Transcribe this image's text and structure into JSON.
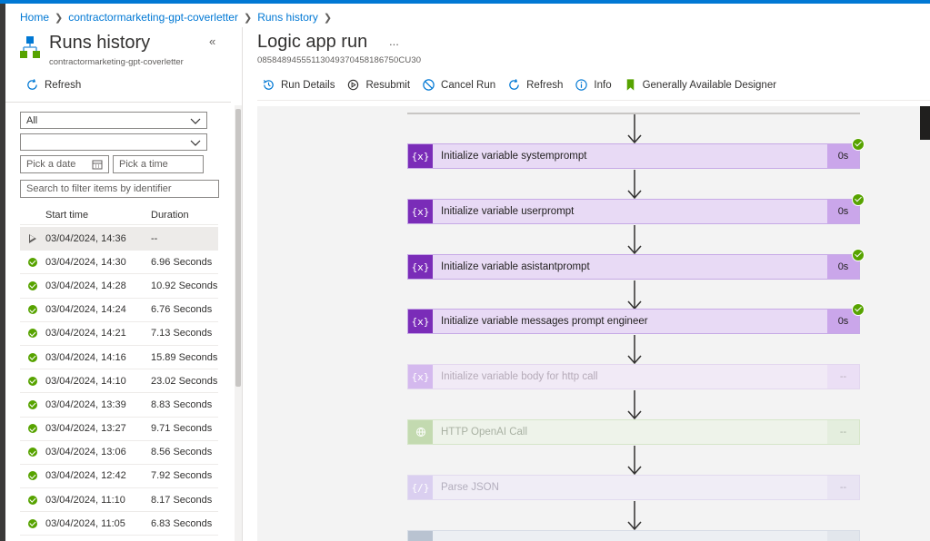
{
  "breadcrumb": [
    "Home",
    "contractormarketing-gpt-coverletter",
    "Runs history"
  ],
  "left_panel": {
    "title": "Runs history",
    "subtitle": "contractormarketing-gpt-coverletter",
    "refresh_label": "Refresh",
    "status_filter": "All",
    "second_filter": "",
    "date_placeholder": "Pick a date",
    "time_placeholder": "Pick a time",
    "search_placeholder": "Search to filter items by identifier",
    "columns": [
      "Start time",
      "Duration"
    ],
    "runs": [
      {
        "status": "running",
        "start": "03/04/2024, 14:36",
        "duration": "--"
      },
      {
        "status": "succeeded",
        "start": "03/04/2024, 14:30",
        "duration": "6.96 Seconds"
      },
      {
        "status": "succeeded",
        "start": "03/04/2024, 14:28",
        "duration": "10.92 Seconds"
      },
      {
        "status": "succeeded",
        "start": "03/04/2024, 14:24",
        "duration": "6.76 Seconds"
      },
      {
        "status": "succeeded",
        "start": "03/04/2024, 14:21",
        "duration": "7.13 Seconds"
      },
      {
        "status": "succeeded",
        "start": "03/04/2024, 14:16",
        "duration": "15.89 Seconds"
      },
      {
        "status": "succeeded",
        "start": "03/04/2024, 14:10",
        "duration": "23.02 Seconds"
      },
      {
        "status": "succeeded",
        "start": "03/04/2024, 13:39",
        "duration": "8.83 Seconds"
      },
      {
        "status": "succeeded",
        "start": "03/04/2024, 13:27",
        "duration": "9.71 Seconds"
      },
      {
        "status": "succeeded",
        "start": "03/04/2024, 13:06",
        "duration": "8.56 Seconds"
      },
      {
        "status": "succeeded",
        "start": "03/04/2024, 12:42",
        "duration": "7.92 Seconds"
      },
      {
        "status": "succeeded",
        "start": "03/04/2024, 11:10",
        "duration": "8.17 Seconds"
      },
      {
        "status": "succeeded",
        "start": "03/04/2024, 11:05",
        "duration": "6.83 Seconds"
      }
    ]
  },
  "main": {
    "title": "Logic app run",
    "more_label": "...",
    "run_id": "08584894555113049370458186750CU30",
    "toolbar": {
      "run_details": "Run Details",
      "resubmit": "Resubmit",
      "cancel_run": "Cancel Run",
      "refresh": "Refresh",
      "info": "Info",
      "designer": "Generally Available Designer"
    },
    "steps": [
      {
        "label": "Initialize variable systemprompt",
        "duration": "0s",
        "icon_text": "{x}",
        "state": "done"
      },
      {
        "label": "Initialize variable userprompt",
        "duration": "0s",
        "icon_text": "{x}",
        "state": "done"
      },
      {
        "label": "Initialize variable asistantprompt",
        "duration": "0s",
        "icon_text": "{x}",
        "state": "done"
      },
      {
        "label": "Initialize variable messages prompt engineer",
        "duration": "0s",
        "icon_text": "{x}",
        "state": "done"
      },
      {
        "label": "Initialize variable body for http call",
        "duration": "--",
        "icon_text": "{x}",
        "state": "pending"
      },
      {
        "label": "HTTP OpenAI Call",
        "duration": "--",
        "icon_text": "",
        "state": "http"
      },
      {
        "label": "Parse JSON",
        "duration": "--",
        "icon_text": "{/}",
        "state": "parse"
      }
    ]
  },
  "colors": {
    "accent": "#0078d4",
    "success": "#57a300",
    "variable_action": "#7a2cb8",
    "designer_bookmark": "#57a300"
  }
}
